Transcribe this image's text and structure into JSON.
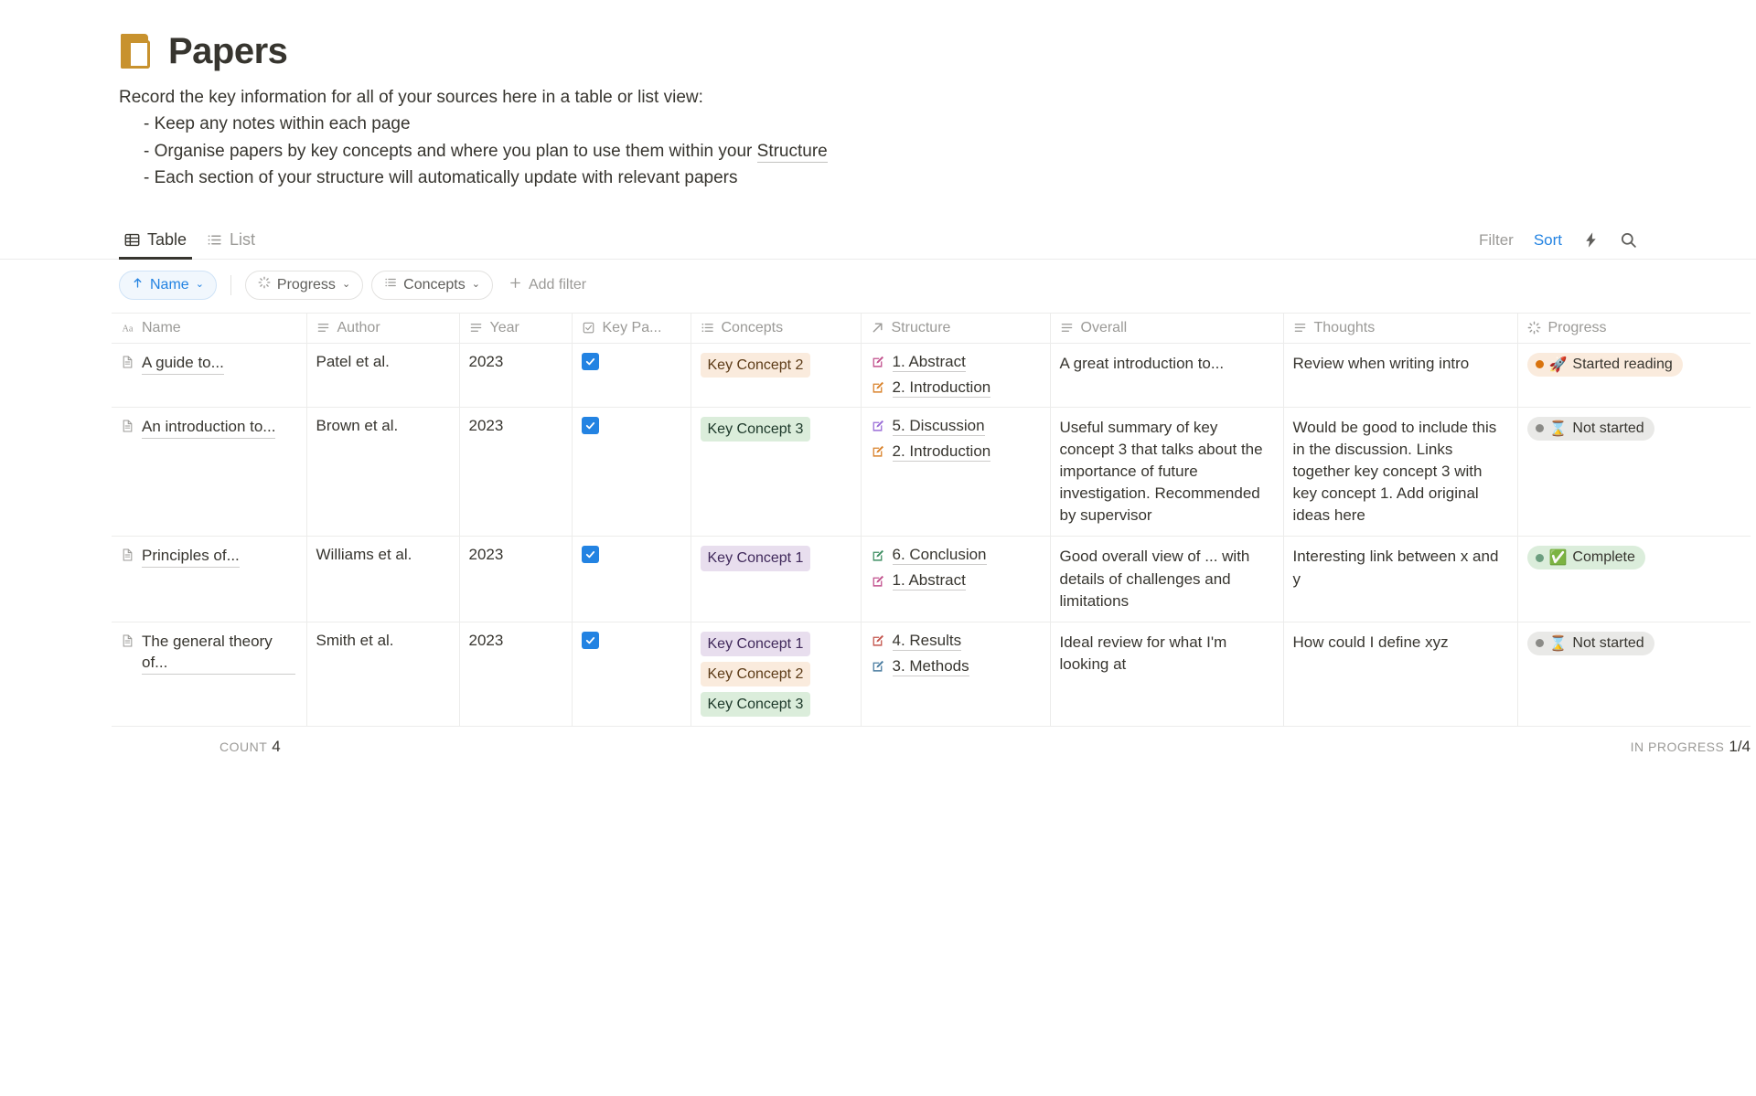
{
  "header": {
    "icon": "closed-book-icon",
    "title": "Papers",
    "description_line": "Record the key information for all of your sources here in a table or list view:",
    "bullets": [
      {
        "prefix": "- Keep any notes within each page",
        "link": "",
        "suffix": ""
      },
      {
        "prefix": "- Organise papers by key concepts and where you plan to use them within your ",
        "link": "Structure",
        "suffix": ""
      },
      {
        "prefix": "- Each section of your structure will automatically update with relevant papers",
        "link": "",
        "suffix": ""
      }
    ]
  },
  "views": [
    {
      "label": "Table",
      "icon": "table-icon",
      "active": true
    },
    {
      "label": "List",
      "icon": "list-icon",
      "active": false
    }
  ],
  "toolbar": {
    "filter_label": "Filter",
    "sort_label": "Sort",
    "lightning_icon": "lightning-bolt-icon",
    "search_icon": "search-icon"
  },
  "chips": {
    "sort": {
      "label": "Name",
      "icon": "arrow-up-icon",
      "caret": "⌄"
    },
    "filters": [
      {
        "label": "Progress",
        "icon": "progress-spinner-icon",
        "caret": "⌄"
      },
      {
        "label": "Concepts",
        "icon": "multi-select-icon",
        "caret": "⌄"
      }
    ],
    "add_filter_label": "Add filter",
    "add_filter_icon": "plus-icon"
  },
  "table": {
    "columns": [
      {
        "label": "Name",
        "icon": "title-text-icon"
      },
      {
        "label": "Author",
        "icon": "text-lines-icon"
      },
      {
        "label": "Year",
        "icon": "text-lines-icon"
      },
      {
        "label": "Key Pa...",
        "icon": "checkbox-icon"
      },
      {
        "label": "Concepts",
        "icon": "multi-select-icon"
      },
      {
        "label": "Structure",
        "icon": "relation-arrow-icon"
      },
      {
        "label": "Overall",
        "icon": "text-lines-icon"
      },
      {
        "label": "Thoughts",
        "icon": "text-lines-icon"
      },
      {
        "label": "Progress",
        "icon": "progress-spinner-icon"
      }
    ],
    "rows": [
      {
        "name": "A guide to...",
        "author": "Patel et al.",
        "year": "2023",
        "key_paper": true,
        "concepts": [
          {
            "label": "Key Concept 2",
            "color": "orange"
          }
        ],
        "structure": [
          {
            "label": "1. Abstract",
            "icon_color": "#c2528e"
          },
          {
            "label": "2. Introduction",
            "icon_color": "#d9822b"
          }
        ],
        "overall": "A great introduction to...",
        "thoughts": "Review when writing intro",
        "progress": {
          "label": "Started reading",
          "emoji": "🚀",
          "color": "orange"
        }
      },
      {
        "name": "An introduction to...",
        "author": "Brown et al.",
        "year": "2023",
        "key_paper": true,
        "concepts": [
          {
            "label": "Key Concept 3",
            "color": "green"
          }
        ],
        "structure": [
          {
            "label": "5. Discussion",
            "icon_color": "#9a6dd7"
          },
          {
            "label": "2. Introduction",
            "icon_color": "#d9822b"
          }
        ],
        "overall": "Useful summary of key concept 3 that talks about the importance of future investigation. Recommended by supervisor",
        "thoughts": "Would be good to include this in the discussion. Links together key concept 3 with key concept 1. Add original ideas here",
        "progress": {
          "label": "Not started",
          "emoji": "⌛",
          "color": "gray"
        }
      },
      {
        "name": "Principles of...",
        "author": "Williams et al.",
        "year": "2023",
        "key_paper": true,
        "concepts": [
          {
            "label": "Key Concept 1",
            "color": "purple"
          }
        ],
        "structure": [
          {
            "label": "6. Conclusion",
            "icon_color": "#3f8f63"
          },
          {
            "label": "1. Abstract",
            "icon_color": "#c2528e"
          }
        ],
        "overall": "Good overall view of ... with details of challenges and limitations",
        "thoughts": "Interesting link between x and y",
        "progress": {
          "label": "Complete",
          "emoji": "✅",
          "color": "green"
        }
      },
      {
        "name": "The general theory of...",
        "author": "Smith et al.",
        "year": "2023",
        "key_paper": true,
        "concepts": [
          {
            "label": "Key Concept 1",
            "color": "purple"
          },
          {
            "label": "Key Concept 2",
            "color": "orange"
          },
          {
            "label": "Key Concept 3",
            "color": "green"
          }
        ],
        "structure": [
          {
            "label": "4. Results",
            "icon_color": "#c4554d"
          },
          {
            "label": "3. Methods",
            "icon_color": "#497ca0"
          }
        ],
        "overall": "Ideal review for what I'm looking at",
        "thoughts": "How could I define xyz",
        "progress": {
          "label": "Not started",
          "emoji": "⌛",
          "color": "gray"
        }
      }
    ]
  },
  "footer": {
    "count_label": "COUNT",
    "count_value": "4",
    "progress_label": "IN PROGRESS",
    "progress_value": "1/4"
  },
  "colors": {
    "accent": "#2383e2",
    "tag_orange_bg": "#faebdd",
    "tag_orange_fg": "#5c3b17",
    "tag_green_bg": "#dbeddb",
    "tag_green_fg": "#1c3829",
    "tag_purple_bg": "#e8deee",
    "tag_purple_fg": "#40295b",
    "pill_orange_bg": "#faebdd",
    "pill_orange_dot": "#d9730d",
    "pill_green_bg": "#dbeddb",
    "pill_green_dot": "#6c9e7f",
    "pill_gray_bg": "#e9e9e7",
    "pill_gray_dot": "#8b8b87"
  }
}
